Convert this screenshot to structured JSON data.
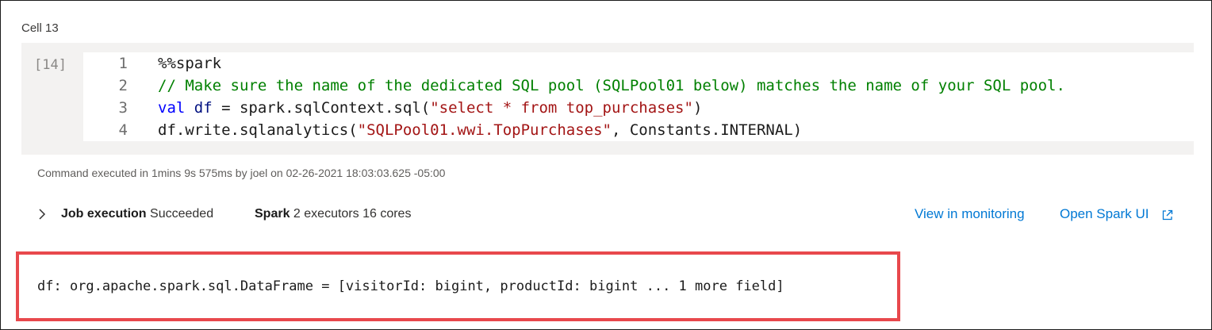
{
  "cell": {
    "label": "Cell 13",
    "exec_count": "[14]",
    "lines": [
      {
        "num": "1",
        "tokens": [
          {
            "t": "%%spark",
            "c": ""
          }
        ]
      },
      {
        "num": "2",
        "tokens": [
          {
            "t": "// Make sure the name of the dedicated SQL pool (SQLPool01 below) matches the name of your SQL pool.",
            "c": "comment"
          }
        ]
      },
      {
        "num": "3",
        "tokens": [
          {
            "t": "val ",
            "c": "kw"
          },
          {
            "t": "df",
            "c": "var"
          },
          {
            "t": " = spark.sqlContext.sql(",
            "c": ""
          },
          {
            "t": "\"select * from top_purchases\"",
            "c": "str"
          },
          {
            "t": ")",
            "c": ""
          }
        ]
      },
      {
        "num": "4",
        "tokens": [
          {
            "t": "df.write.sqlanalytics(",
            "c": ""
          },
          {
            "t": "\"SQLPool01.wwi.TopPurchases\"",
            "c": "str"
          },
          {
            "t": ", Constants.INTERNAL)",
            "c": ""
          }
        ]
      }
    ]
  },
  "execution": {
    "info": "Command executed in 1mins 9s 575ms by joel on 02-26-2021 18:03:03.625 -05:00"
  },
  "job": {
    "label": "Job execution",
    "status": "Succeeded",
    "spark_label": "Spark",
    "spark_detail": "2 executors 16 cores",
    "link_monitoring": "View in monitoring",
    "link_spark_ui": "Open Spark UI"
  },
  "output": {
    "text": "df: org.apache.spark.sql.DataFrame = [visitorId: bigint, productId: bigint ... 1 more field]"
  },
  "icons": {
    "expand": "chevron-right-icon",
    "external": "external-link-icon"
  },
  "colors": {
    "link": "#0078d4",
    "highlight_border": "#e8484c",
    "comment": "#008000",
    "string": "#a31515",
    "keyword": "#0000ff"
  }
}
